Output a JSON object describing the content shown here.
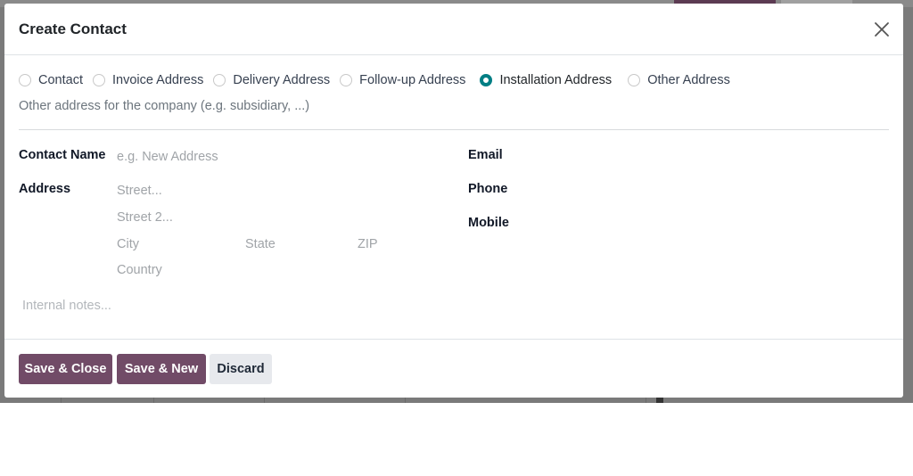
{
  "dialog": {
    "title": "Create Contact"
  },
  "address_types": [
    {
      "label": "Contact",
      "checked": false
    },
    {
      "label": "Invoice Address",
      "checked": false
    },
    {
      "label": "Delivery Address",
      "checked": false
    },
    {
      "label": "Follow-up Address",
      "checked": false
    },
    {
      "label": "Installation Address",
      "checked": true
    },
    {
      "label": "Other Address",
      "checked": false
    }
  ],
  "help_text": "Other address for the company (e.g. subsidiary, ...)",
  "form": {
    "contact_name_label": "Contact Name",
    "contact_name_placeholder": "e.g. New Address",
    "address_label": "Address",
    "street_placeholder": "Street...",
    "street2_placeholder": "Street 2...",
    "city_placeholder": "City",
    "state_placeholder": "State",
    "zip_placeholder": "ZIP",
    "country_placeholder": "Country",
    "email_label": "Email",
    "phone_label": "Phone",
    "mobile_label": "Mobile",
    "notes_placeholder": "Internal notes..."
  },
  "footer": {
    "save_close_label": "Save & Close",
    "save_new_label": "Save & New",
    "discard_label": "Discard"
  },
  "colors": {
    "primary": "#714b67",
    "radio_checked": "#017e84",
    "backdrop": "#7a7a7a"
  },
  "icons": {
    "close": "close-icon"
  }
}
